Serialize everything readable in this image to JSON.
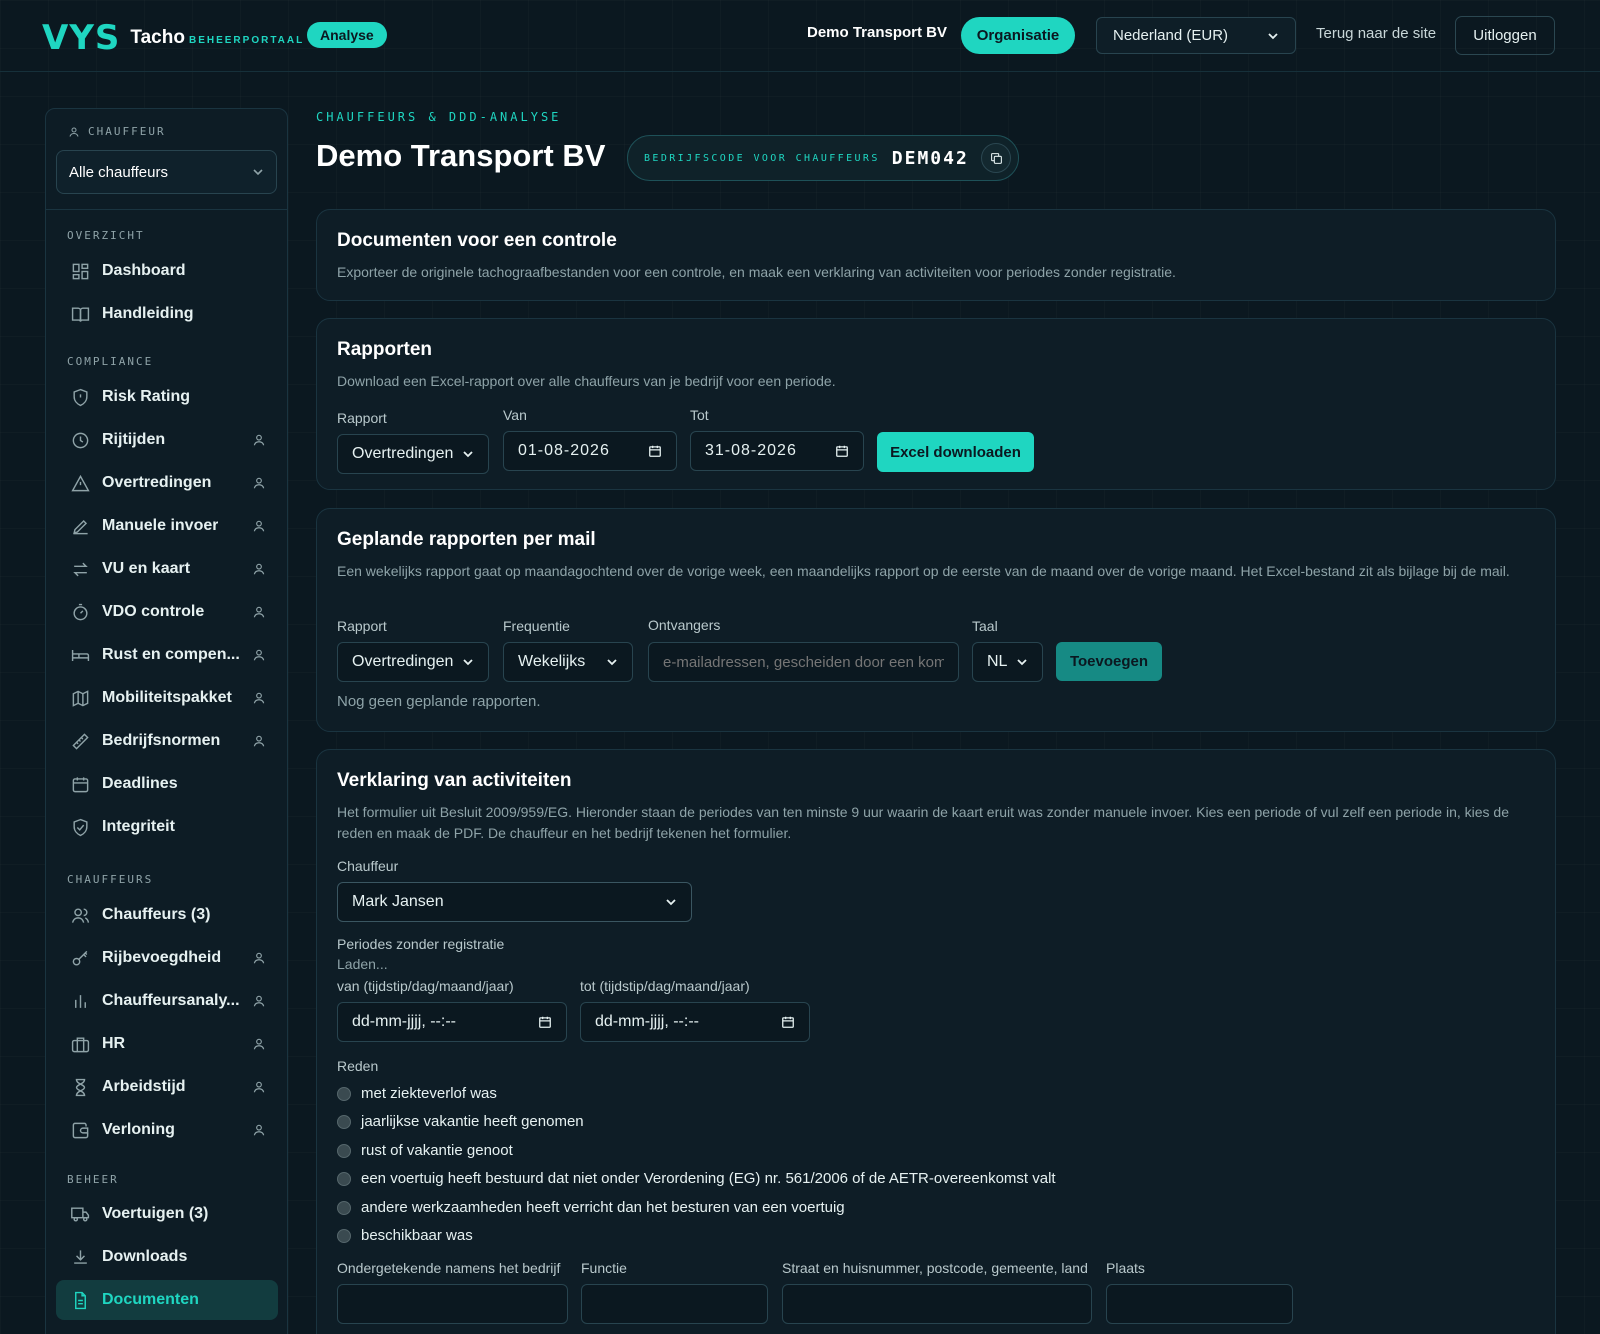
{
  "header": {
    "logo_mark": "VYS",
    "app_name": "Tacho",
    "portal_label": "BEHEERPORTAAL",
    "analyse_badge": "Analyse",
    "org_name": "Demo Transport BV",
    "org_button": "Organisatie",
    "country_select": "Nederland (EUR)",
    "back_link": "Terug naar de site",
    "logout_button": "Uitloggen"
  },
  "sidebar": {
    "driver_label": "CHAUFFEUR",
    "driver_select": "Alle chauffeurs",
    "sections": {
      "overview": "OVERZICHT",
      "compliance": "COMPLIANCE",
      "drivers": "CHAUFFEURS",
      "manage": "BEHEER"
    },
    "items": {
      "dashboard": "Dashboard",
      "manual": "Handleiding",
      "risk": "Risk Rating",
      "driving_times": "Rijtijden",
      "violations": "Overtredingen",
      "manual_entry": "Manuele invoer",
      "vu_card": "VU en kaart",
      "vdo": "VDO controle",
      "rest": "Rust en compen...",
      "mobility": "Mobiliteitspakket",
      "norms": "Bedrijfsnormen",
      "deadlines": "Deadlines",
      "integrity": "Integriteit",
      "drivers": "Chauffeurs (3)",
      "license": "Rijbevoegdheid",
      "driver_analysis": "Chauffeursanaly...",
      "hr": "HR",
      "working_time": "Arbeidstijd",
      "payroll": "Verloning",
      "vehicles": "Voertuigen (3)",
      "downloads": "Downloads",
      "documents": "Documenten"
    }
  },
  "main": {
    "kicker": "CHAUFFEURS & DDD-ANALYSE",
    "title": "Demo Transport BV",
    "company_code_label": "BEDRIJFSCODE VOOR CHAUFFEURS",
    "company_code": "DEM042"
  },
  "card_control": {
    "title": "Documenten voor een controle",
    "desc": "Exporteer de originele tachograafbestanden voor een controle, en maak een verklaring van activiteiten voor periodes zonder registratie."
  },
  "card_reports": {
    "title": "Rapporten",
    "desc": "Download een Excel-rapport over alle chauffeurs van je bedrijf voor een periode.",
    "report_label": "Rapport",
    "report_value": "Overtredingen",
    "from_label": "Van",
    "from_value": "01-08-2026",
    "to_label": "Tot",
    "to_value": "31-08-2026",
    "download_button": "Excel downloaden"
  },
  "card_scheduled": {
    "title": "Geplande rapporten per mail",
    "desc": "Een wekelijks rapport gaat op maandagochtend over de vorige week, een maandelijks rapport op de eerste van de maand over de vorige maand. Het Excel-bestand zit als bijlage bij de mail.",
    "report_label": "Rapport",
    "report_value": "Overtredingen",
    "frequency_label": "Frequentie",
    "frequency_value": "Wekelijks",
    "recipients_label": "Ontvangers",
    "recipients_placeholder": "e-mailadressen, gescheiden door een komma",
    "language_label": "Taal",
    "language_value": "NL",
    "add_button": "Toevoegen",
    "empty_note": "Nog geen geplande rapporten."
  },
  "card_declaration": {
    "title": "Verklaring van activiteiten",
    "desc": "Het formulier uit Besluit 2009/959/EG. Hieronder staan de periodes van ten minste 9 uur waarin de kaart eruit was zonder manuele invoer. Kies een periode of vul zelf een periode in, kies de reden en maak de PDF. De chauffeur en het bedrijf tekenen het formulier.",
    "driver_label": "Chauffeur",
    "driver_value": "Mark Jansen",
    "periods_label": "Periodes zonder registratie",
    "loading": "Laden...",
    "from_label": "van (tijdstip/dag/maand/jaar)",
    "from_placeholder": "dd-mm-jjjj, --:--",
    "to_label": "tot (tijdstip/dag/maand/jaar)",
    "to_placeholder": "dd-mm-jjjj, --:--",
    "reason_label": "Reden",
    "reasons": [
      "met ziekteverlof was",
      "jaarlijkse vakantie heeft genomen",
      "rust of vakantie genoot",
      "een voertuig heeft bestuurd dat niet onder Verordening (EG) nr. 561/2006 of de AETR-overeenkomst valt",
      "andere werkzaamheden heeft verricht dan het besturen van een voertuig",
      "beschikbaar was"
    ],
    "signer_label": "Ondergetekende namens het bedrijf",
    "function_label": "Functie",
    "address_label": "Straat en huisnummer, postcode, gemeente, land",
    "place_label": "Plaats"
  }
}
